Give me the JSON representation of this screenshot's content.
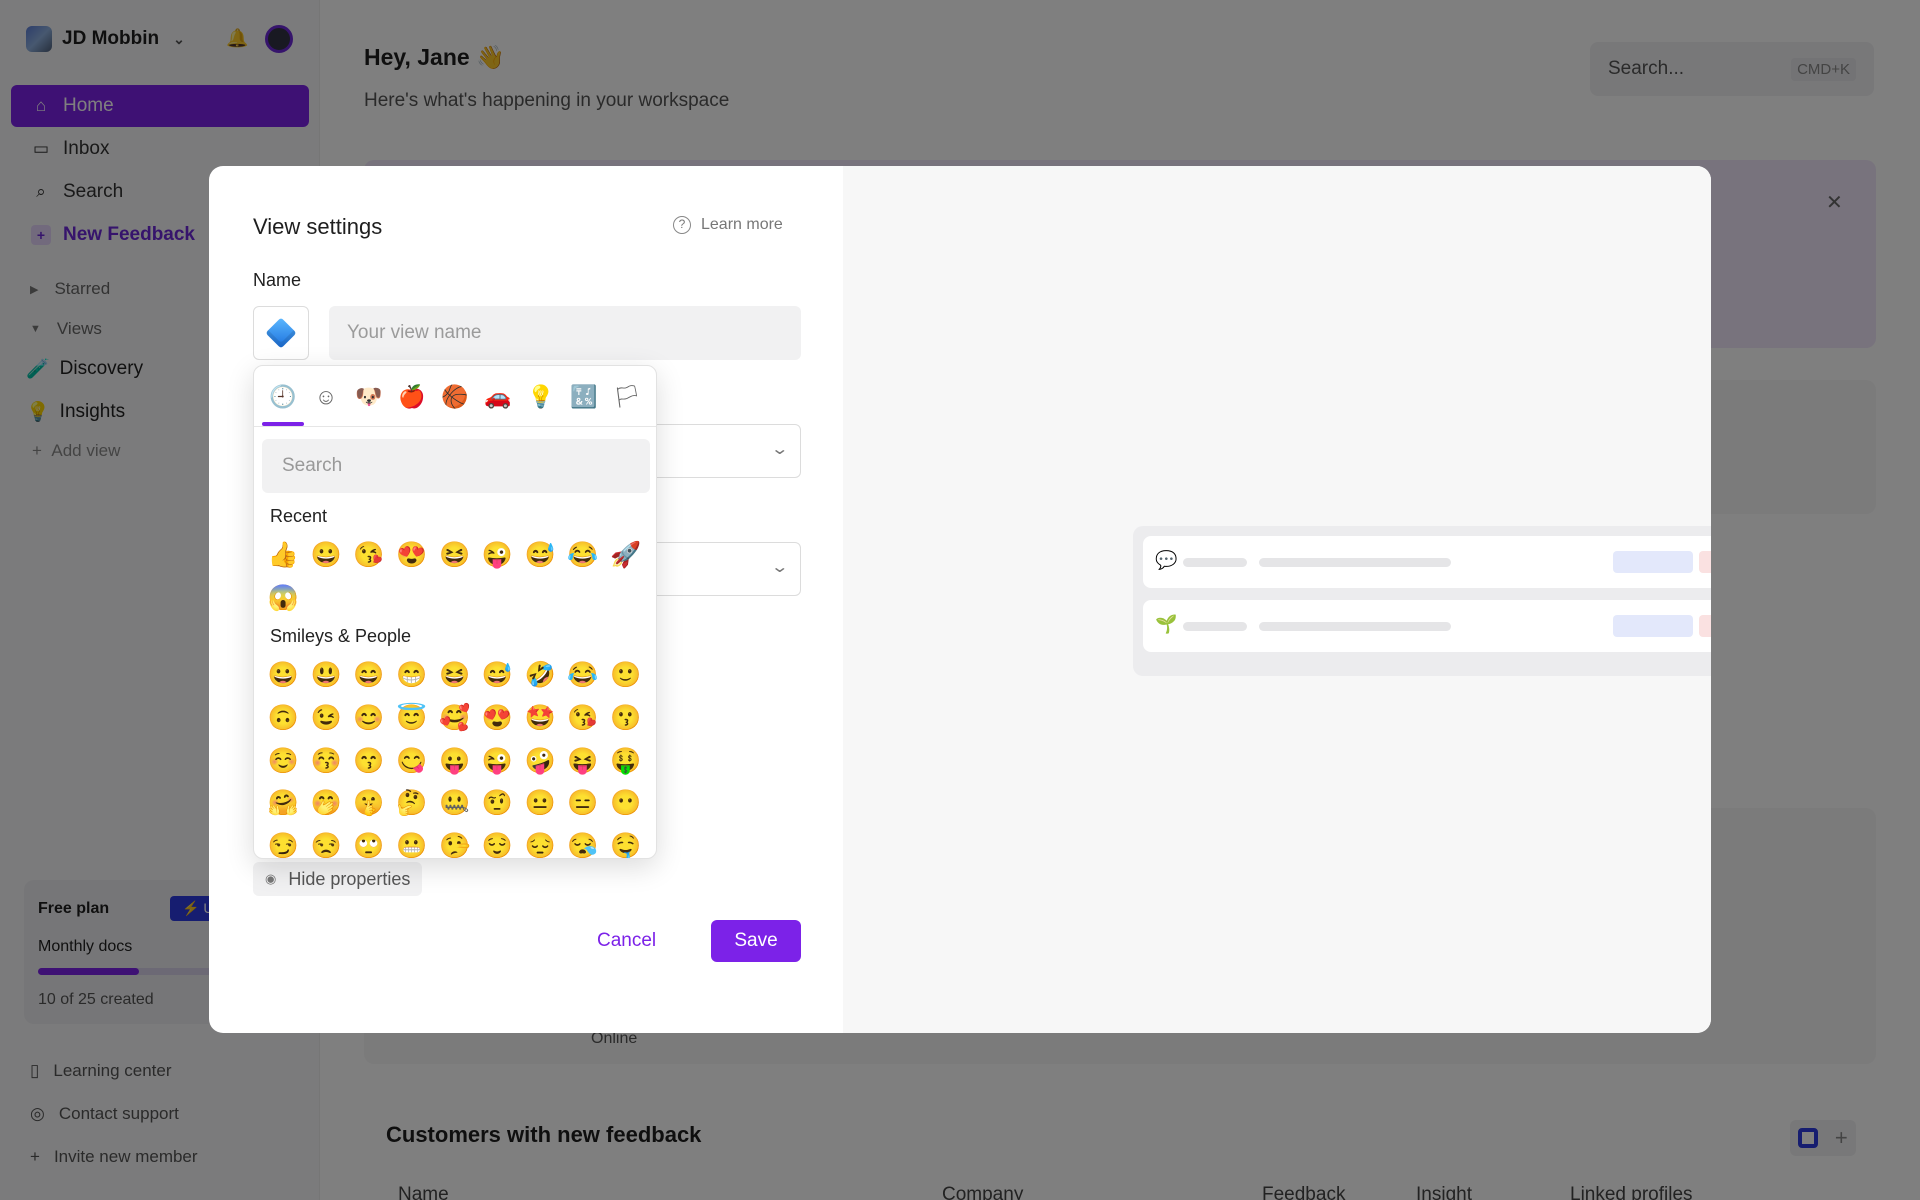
{
  "sidebar": {
    "workspace_name": "JD Mobbin",
    "nav": [
      {
        "label": "Home",
        "icon": "home-icon",
        "glyph": "⌂"
      },
      {
        "label": "Inbox",
        "icon": "inbox-icon",
        "glyph": "▭"
      },
      {
        "label": "Search",
        "icon": "search-icon",
        "glyph": "⌕"
      },
      {
        "label": "New Feedback",
        "icon": "plus-icon",
        "glyph": "+"
      }
    ],
    "sections": {
      "starred": "Starred",
      "views": "Views"
    },
    "views": [
      {
        "label": "Discovery",
        "emoji": "🧪"
      },
      {
        "label": "Insights",
        "emoji": "💡"
      }
    ],
    "add_view": "Add view",
    "plan": {
      "title": "Free plan",
      "upgrade": "⚡ U",
      "metric": "Monthly docs",
      "used": 10,
      "limit": 25,
      "count_text": "10 of 25 created"
    },
    "footer": [
      {
        "label": "Learning center",
        "glyph": "▯"
      },
      {
        "label": "Contact support",
        "glyph": "◎"
      },
      {
        "label": "Invite new member",
        "glyph": "+"
      }
    ]
  },
  "main": {
    "greeting": "Hey, Jane 👋",
    "subtitle": "Here's what's happening in your workspace",
    "search_placeholder": "Search...",
    "search_shortcut": "CMD+K",
    "online_label": "Online",
    "customers_title": "Customers with new feedback",
    "columns": [
      "Name",
      "Company",
      "Feedback",
      "Insight",
      "Linked profiles"
    ]
  },
  "modal": {
    "title": "View settings",
    "learn_more": "Learn more",
    "name_label": "Name",
    "name_placeholder": "Your view name",
    "selected_emoji": "🔷",
    "hide_properties": "Hide properties",
    "cancel": "Cancel",
    "save": "Save"
  },
  "emoji_picker": {
    "tabs": [
      {
        "name": "recent-tab-icon",
        "glyph": "🕘"
      },
      {
        "name": "smileys-tab-icon",
        "glyph": "☺"
      },
      {
        "name": "animals-tab-icon",
        "glyph": "🐶"
      },
      {
        "name": "food-tab-icon",
        "glyph": "🍎"
      },
      {
        "name": "activity-tab-icon",
        "glyph": "🏀"
      },
      {
        "name": "travel-tab-icon",
        "glyph": "🚗"
      },
      {
        "name": "objects-tab-icon",
        "glyph": "💡"
      },
      {
        "name": "symbols-tab-icon",
        "glyph": "🔣"
      },
      {
        "name": "flags-tab-icon",
        "glyph": "🏳"
      }
    ],
    "search_placeholder": "Search",
    "recent_label": "Recent",
    "recent": [
      "👍",
      "😀",
      "😘",
      "😍",
      "😆",
      "😜",
      "😅",
      "😂",
      "🚀",
      "😱"
    ],
    "smileys_label": "Smileys & People",
    "smileys": [
      "😀",
      "😃",
      "😄",
      "😁",
      "😆",
      "😅",
      "🤣",
      "😂",
      "🙂",
      "🙃",
      "😉",
      "😊",
      "😇",
      "🥰",
      "😍",
      "🤩",
      "😘",
      "😗",
      "☺️",
      "😚",
      "😙",
      "😋",
      "😛",
      "😜",
      "🤪",
      "😝",
      "🤑",
      "🤗",
      "🤭",
      "🤫",
      "🤔",
      "🤐",
      "🤨",
      "😐",
      "😑",
      "😶",
      "😏",
      "😒",
      "🙄",
      "😬",
      "🤥",
      "😌",
      "😔",
      "😪",
      "🤤"
    ]
  },
  "preview": {
    "rows": [
      {
        "emoji": "💬"
      },
      {
        "emoji": "🌱"
      }
    ]
  },
  "colors": {
    "accent": "#7c22e8",
    "upgrade": "#2d3be0"
  }
}
